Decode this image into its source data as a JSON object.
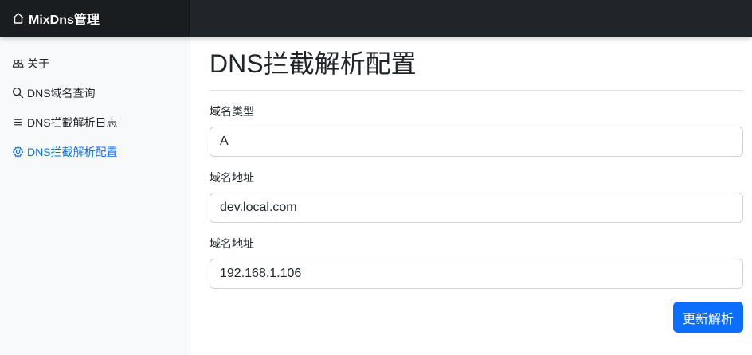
{
  "brand": {
    "title": "MixDns管理",
    "icon": "house-icon"
  },
  "sidebar": {
    "items": [
      {
        "label": "关于",
        "icon": "people-icon",
        "active": false
      },
      {
        "label": "DNS域名查询",
        "icon": "search-icon",
        "active": false
      },
      {
        "label": "DNS拦截解析日志",
        "icon": "list-icon",
        "active": false
      },
      {
        "label": "DNS拦截解析配置",
        "icon": "gear-icon",
        "active": true
      }
    ]
  },
  "main": {
    "title": "DNS拦截解析配置",
    "form": {
      "fields": [
        {
          "label": "域名类型",
          "value": "A"
        },
        {
          "label": "域名地址",
          "value": "dev.local.com"
        },
        {
          "label": "域名地址",
          "value": "192.168.1.106"
        }
      ],
      "submit_label": "更新解析"
    }
  },
  "colors": {
    "navbar": "#212529",
    "brand_bg": "#1a1d20",
    "sidebar_bg": "#f8f9fa",
    "accent": "#0d6efd"
  }
}
